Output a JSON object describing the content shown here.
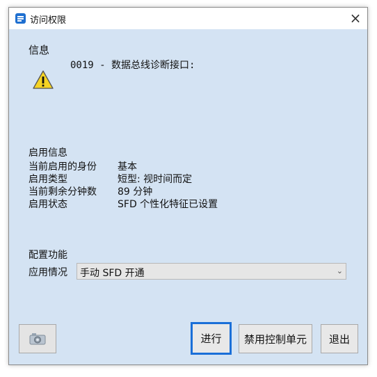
{
  "window": {
    "title": "访问权限",
    "close_glyph": "×"
  },
  "info": {
    "heading": "信息",
    "message": "0019 - 数据总线诊断接口:",
    "icon": "warning-icon"
  },
  "activation": {
    "heading": "启用信息",
    "rows": [
      {
        "label": "当前启用的身份",
        "value": "基本"
      },
      {
        "label": "启用类型",
        "value": "短型: 视时间而定"
      },
      {
        "label": "当前剩余分钟数",
        "value": "89 分钟"
      },
      {
        "label": "启用状态",
        "value": "SFD 个性化特征已设置"
      }
    ]
  },
  "config": {
    "heading": "配置功能",
    "application_label": "应用情况",
    "application_value": "手动 SFD 开通",
    "chevron_icon": "chevron-down-icon"
  },
  "buttons": {
    "camera_icon": "camera-icon",
    "proceed": "进行",
    "disable_control_unit": "禁用控制单元",
    "exit": "退出"
  },
  "colors": {
    "dialog_background": "#d4e3f3",
    "primary_button_border": "#1a6fd8",
    "warning_yellow": "#f5d324"
  }
}
